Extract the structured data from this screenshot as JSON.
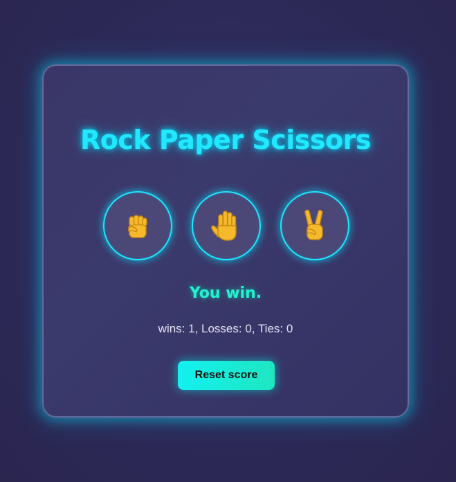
{
  "game": {
    "title": "Rock Paper Scissors",
    "choices": [
      {
        "id": "rock",
        "icon": "raised-fist-icon",
        "glyph": "✊"
      },
      {
        "id": "paper",
        "icon": "raised-hand-icon",
        "glyph": "🖐"
      },
      {
        "id": "scissors",
        "icon": "victory-hand-icon",
        "glyph": "✌"
      }
    ],
    "result": "You win.",
    "score_text": "wins: 1, Losses: 0, Ties: 0",
    "reset_label": "Reset score"
  },
  "colors": {
    "accent": "#22e8ff",
    "result": "#22f3cf",
    "hand": "#f6b92c",
    "background": "#2e2a5a",
    "card": "#3a3668"
  }
}
